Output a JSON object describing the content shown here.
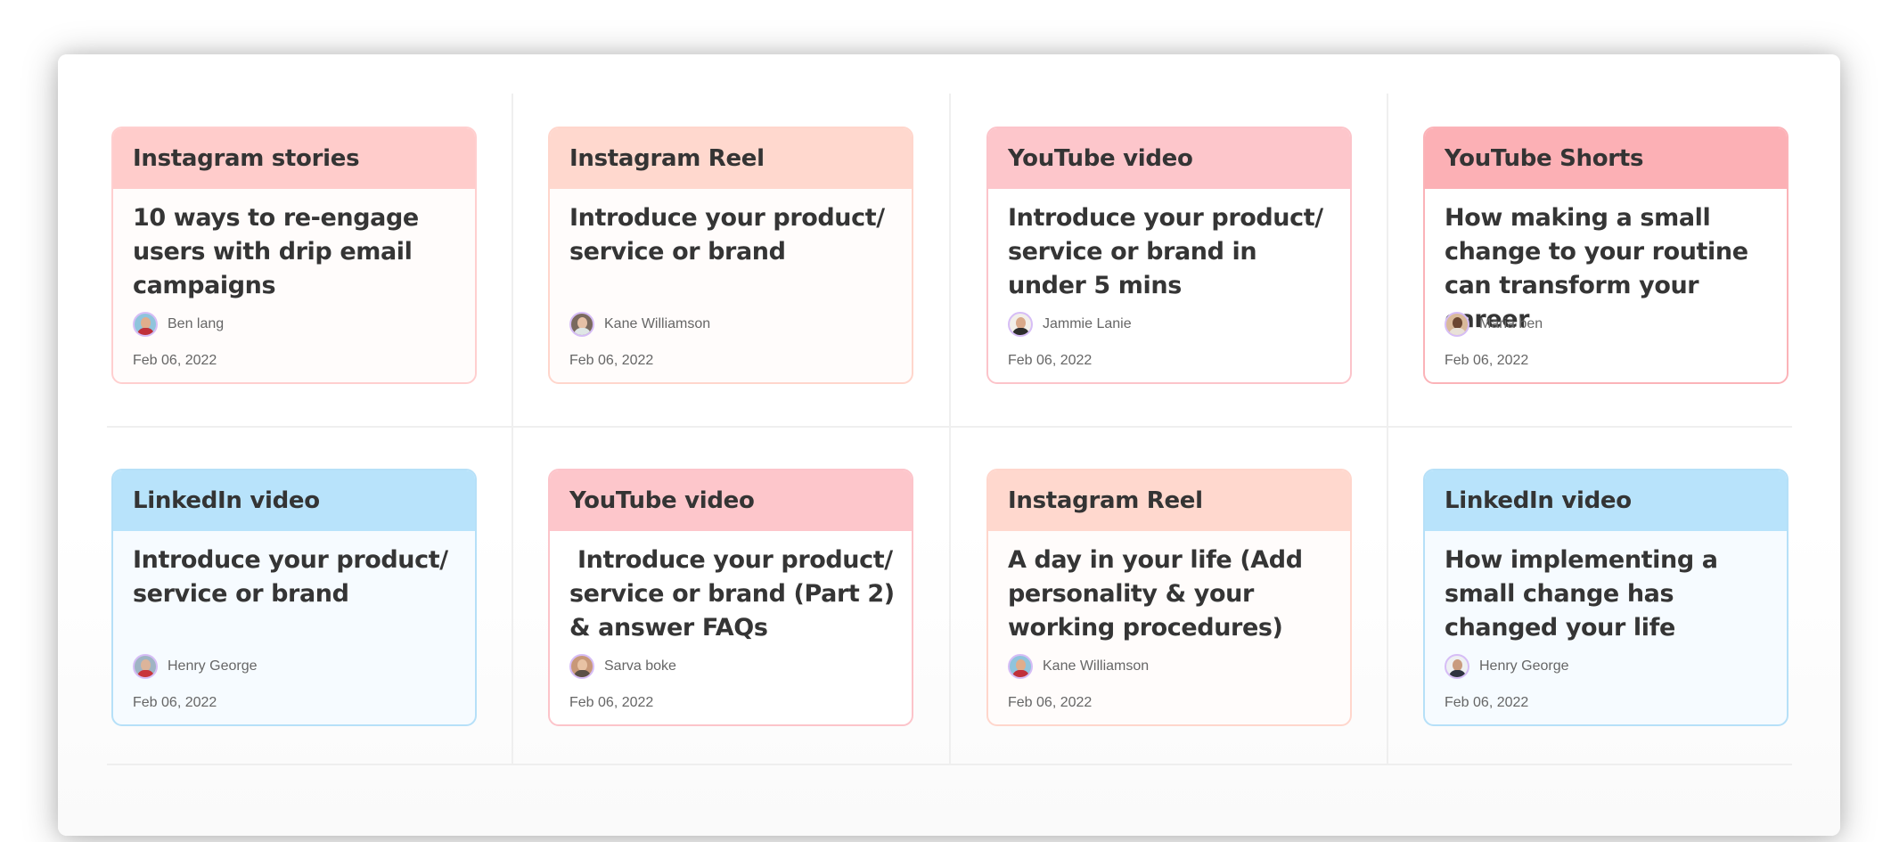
{
  "cards": [
    {
      "category": "Instagram stories",
      "title": "10 ways to re-engage users with drip email campaigns",
      "author": "Ben lang",
      "date": "Feb 06, 2022",
      "colors": {
        "header": "#ffcccb",
        "border": "#ffcfcf",
        "body": "#fffcfb"
      },
      "avatar_colors": {
        "bg": "#8fc4dc",
        "face": "#e0ad8c",
        "torso": "#c0303a"
      }
    },
    {
      "category": "Instagram Reel",
      "title": "Introduce your product/ service or brand",
      "author": "Kane Williamson",
      "date": "Feb 06, 2022",
      "colors": {
        "header": "#ffd8ce",
        "border": "#ffd6cc",
        "body": "#fffcfb"
      },
      "avatar_colors": {
        "bg": "#7a6a5e",
        "face": "#e6c0a6",
        "torso": "#dfe6e6"
      }
    },
    {
      "category": "YouTube video",
      "title": "Introduce your product/ service or brand in under 5 mins",
      "author": "Jammie Lanie",
      "date": "Feb 06, 2022",
      "colors": {
        "header": "#fdc6cb",
        "border": "#fcc4ca",
        "body": "#ffffff"
      },
      "avatar_colors": {
        "bg": "#f2efe9",
        "face": "#d9a98a",
        "torso": "#2d2d2d"
      }
    },
    {
      "category": "YouTube Shorts",
      "title": "How making a small change to your routine can transform your career",
      "author": "Maria ben",
      "date": "Feb 06, 2022",
      "colors": {
        "header": "#fcb0b5",
        "border": "#fbb3b8",
        "body": "#ffffff"
      },
      "avatar_colors": {
        "bg": "#d9b99a",
        "face": "#6b4632",
        "torso": "#e9e1d8"
      }
    },
    {
      "category": "LinkedIn video",
      "title": "Introduce your product/ service or brand",
      "author": "Henry George",
      "date": "Feb 06, 2022",
      "colors": {
        "header": "#b8e3fb",
        "border": "#b6e0f8",
        "body": "#f6fbff"
      },
      "avatar_colors": {
        "bg": "#9fb4c4",
        "face": "#dcb49a",
        "torso": "#c8353a"
      }
    },
    {
      "category": "YouTube video",
      "title": " Introduce your product/ service or brand (Part 2) & answer FAQs",
      "author": "Sarva boke",
      "date": "Feb 06, 2022",
      "colors": {
        "header": "#fdc6cb",
        "border": "#fcc4ca",
        "body": "#ffffff"
      },
      "avatar_colors": {
        "bg": "#c89878",
        "face": "#e8c2a4",
        "torso": "#5b5046"
      }
    },
    {
      "category": "Instagram Reel",
      "title": "A day in your life (Add personality & your working procedures)",
      "author": "Kane Williamson",
      "date": "Feb 06, 2022",
      "colors": {
        "header": "#ffd8ce",
        "border": "#ffd6cc",
        "body": "#fffcfb"
      },
      "avatar_colors": {
        "bg": "#8fc4dc",
        "face": "#e0ad8c",
        "torso": "#c0303a"
      }
    },
    {
      "category": "LinkedIn video",
      "title": "How implementing a small change has changed your life",
      "author": "Henry George",
      "date": "Feb 06, 2022",
      "colors": {
        "header": "#b8e3fb",
        "border": "#b6e0f8",
        "body": "#f6fbff"
      },
      "avatar_colors": {
        "bg": "#eef0f2",
        "face": "#c99b7e",
        "torso": "#2f3340"
      }
    }
  ]
}
